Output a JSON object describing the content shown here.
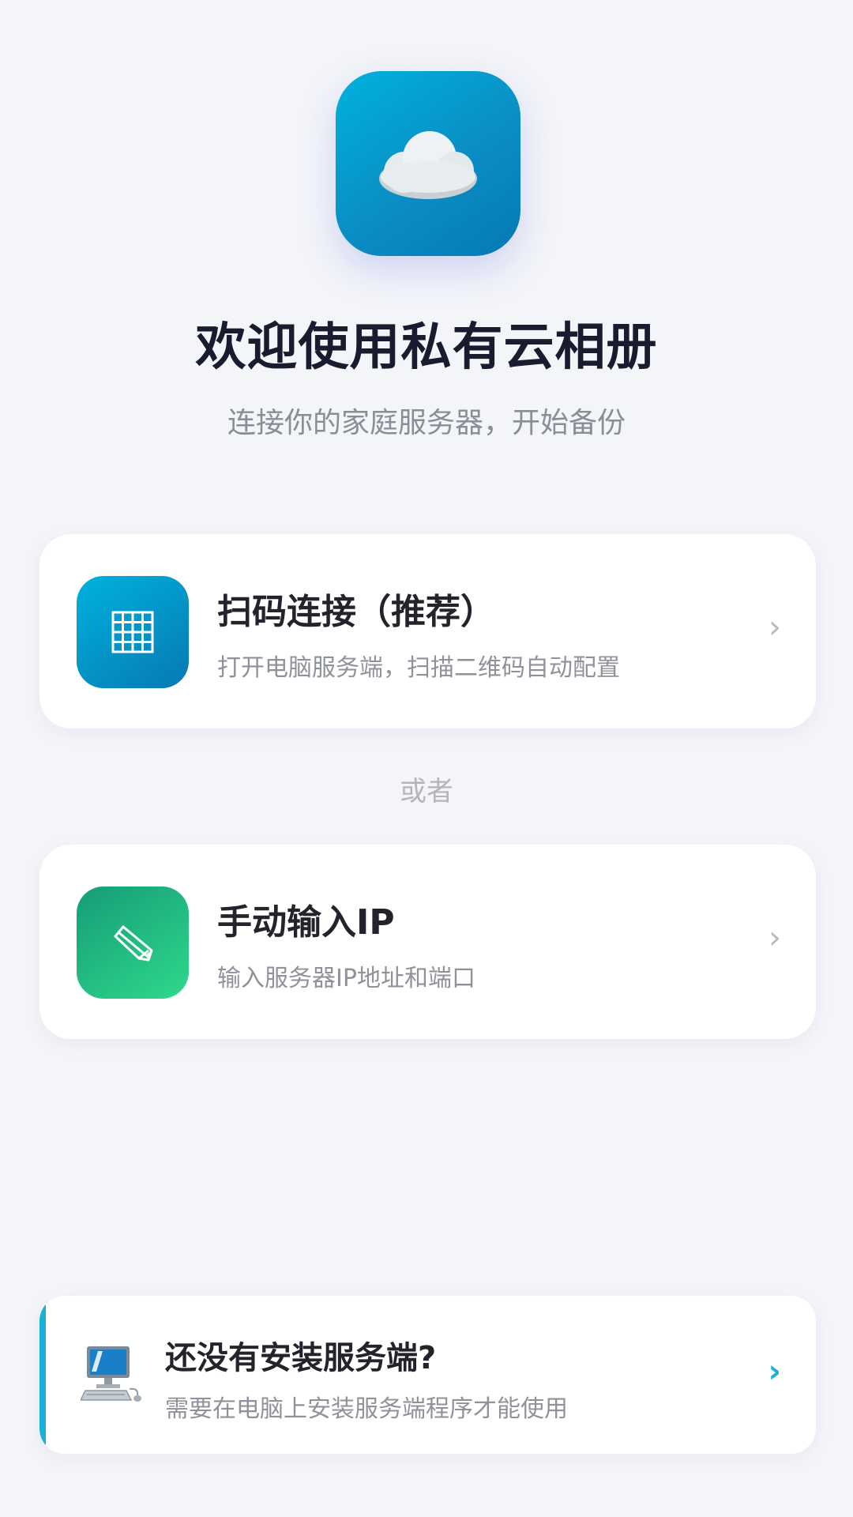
{
  "header": {
    "app_icon": "cloud-icon",
    "title": "欢迎使用私有云相册",
    "subtitle": "连接你的家庭服务器，开始备份"
  },
  "options": [
    {
      "icon": "qr-code-icon",
      "title": "扫码连接（推荐）",
      "description": "打开电脑服务端，扫描二维码自动配置",
      "chevron": "›",
      "icon_color": "#0a8ec4"
    },
    {
      "icon": "pencil-icon",
      "title": "手动输入IP",
      "description": "输入服务器IP地址和端口",
      "chevron": "›",
      "icon_color": "#22c283"
    }
  ],
  "divider": "或者",
  "install": {
    "icon": "computer-icon",
    "title": "还没有安装服务端?",
    "description": "需要在电脑上安装服务端程序才能使用",
    "chevron": "›",
    "accent_color": "#1ab0d8"
  }
}
